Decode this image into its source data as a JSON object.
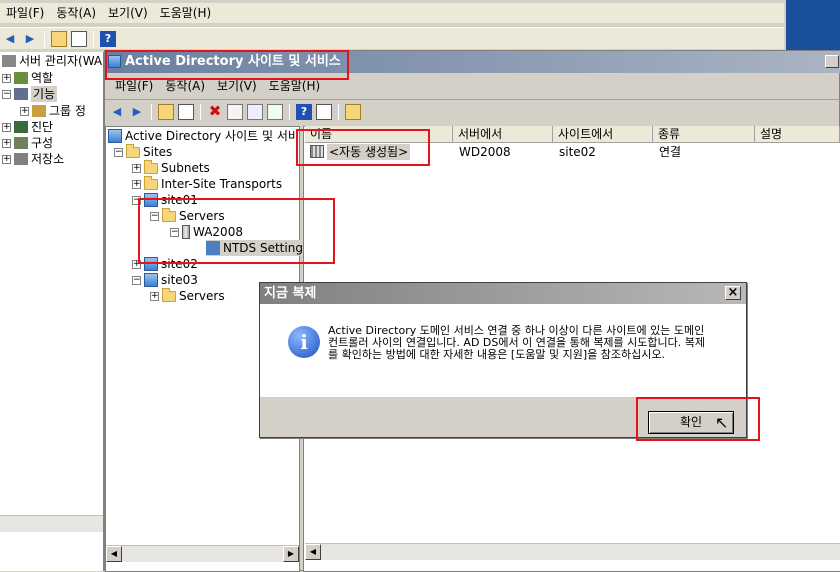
{
  "outer": {
    "menu": [
      "파일(F)",
      "동작(A)",
      "보기(V)",
      "도움말(H)"
    ],
    "tree": [
      {
        "label": "서버 관리자(WA"
      },
      {
        "label": "역할"
      },
      {
        "label": "기능"
      },
      {
        "label": "그룹 정"
      },
      {
        "label": "진단"
      },
      {
        "label": "구성"
      },
      {
        "label": "저장소"
      }
    ]
  },
  "inner": {
    "title": "Active Directory 사이트 및 서비스",
    "menu": [
      "파일(F)",
      "동작(A)",
      "보기(V)",
      "도움말(H)"
    ],
    "tree": [
      {
        "label": "Active Directory 사이트 및 서비"
      },
      {
        "label": "Sites"
      },
      {
        "label": "Subnets"
      },
      {
        "label": "Inter-Site Transports"
      },
      {
        "label": "site01"
      },
      {
        "label": "Servers"
      },
      {
        "label": "WA2008"
      },
      {
        "label": "NTDS Setting"
      },
      {
        "label": "site02"
      },
      {
        "label": "site03"
      },
      {
        "label": "Servers"
      }
    ],
    "columns": [
      "이름",
      "서버에서",
      "사이트에서",
      "종류",
      "설명"
    ],
    "rows": [
      {
        "name": "<자동 생성됨>",
        "from_server": "WD2008",
        "from_site": "site02",
        "type": "연결",
        "desc": ""
      }
    ]
  },
  "dialog": {
    "title": "지금 복제",
    "message": "Active Directory 도메인 서비스 연결 중 하나 이상이 다른 사이트에 있는 도메인 컨트롤러 사이의 연결입니다. AD DS에서 이 연결을 통해 복제를 시도합니다. 복제를 확인하는 방법에 대한 자세한 내용은 [도움말 및 지원]을 참조하십시오.",
    "ok_label": "확인",
    "close_glyph": "×"
  },
  "icons": {
    "info": "i",
    "help": "?"
  }
}
